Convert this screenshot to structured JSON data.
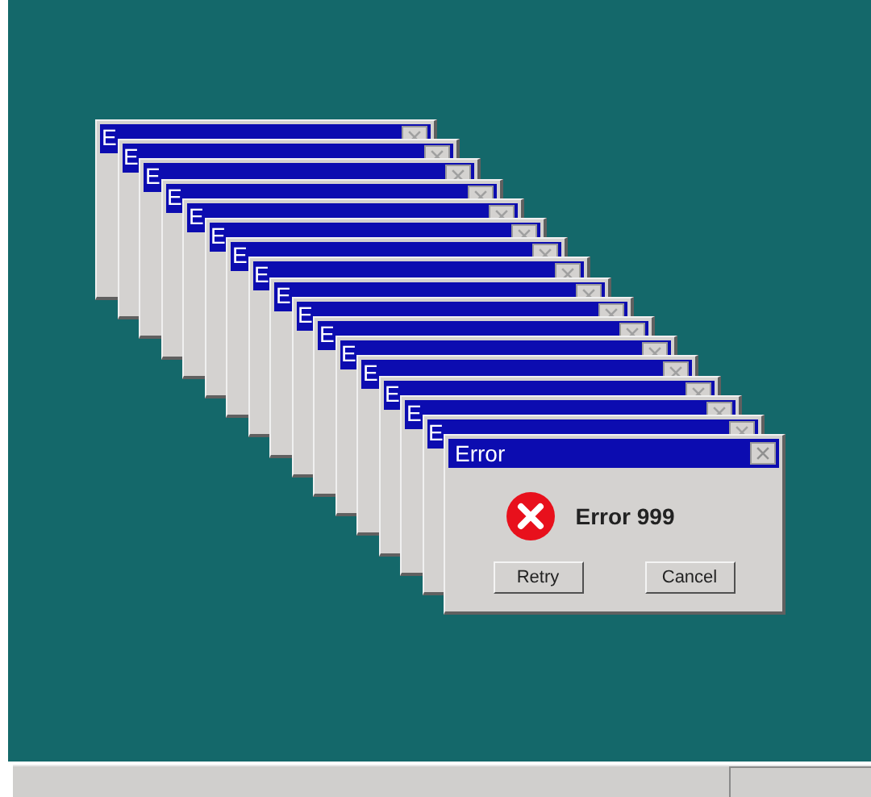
{
  "windows": [
    {
      "kind": "stacked",
      "title": "E"
    },
    {
      "kind": "stacked",
      "title": "E"
    },
    {
      "kind": "stacked",
      "title": "E"
    },
    {
      "kind": "stacked",
      "title": "E"
    },
    {
      "kind": "stacked",
      "title": "E"
    },
    {
      "kind": "stacked",
      "title": "E"
    },
    {
      "kind": "stacked",
      "title": "E"
    },
    {
      "kind": "stacked",
      "title": "E"
    },
    {
      "kind": "stacked",
      "title": "E"
    },
    {
      "kind": "stacked",
      "title": "E"
    },
    {
      "kind": "stacked",
      "title": "E"
    },
    {
      "kind": "stacked",
      "title": "E"
    },
    {
      "kind": "stacked",
      "title": "E"
    },
    {
      "kind": "stacked",
      "title": "E"
    },
    {
      "kind": "stacked",
      "title": "E"
    },
    {
      "kind": "stacked",
      "title": "E"
    },
    {
      "kind": "dialog",
      "title": "Error",
      "message": "Error 999",
      "buttons": [
        "Retry",
        "Cancel"
      ]
    }
  ]
}
